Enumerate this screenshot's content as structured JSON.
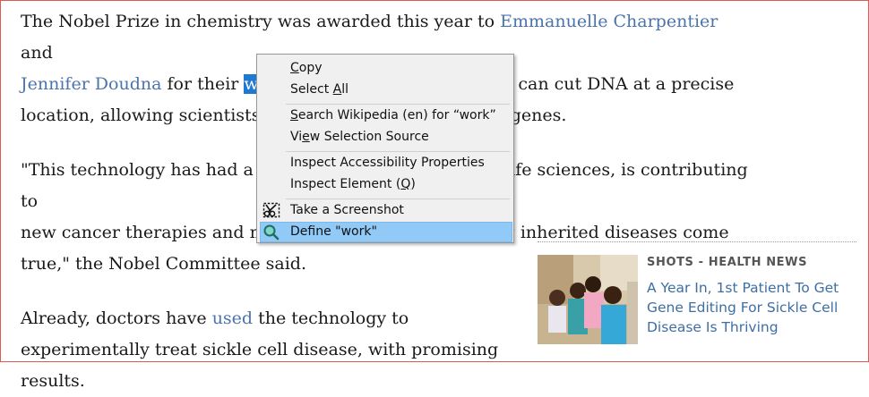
{
  "article": {
    "p1": {
      "t1": "The Nobel Prize in chemistry was awarded this year to ",
      "link1": "Emmanuelle Charpentier",
      "t2": " and",
      "link2": "Jennifer Doudna",
      "t3": " for their ",
      "selected": "work",
      "t4": " on \"genetic scissors\" that can cut DNA at a precise",
      "t5": "location, allowing scientists to make changes to specific genes."
    },
    "p2": {
      "l1": "\"This technology has had a revolutionary impact on the life sciences, is contributing to",
      "l2": "new cancer therapies and may make the dream of curing inherited diseases come",
      "l3": "true,\" the Nobel Committee said."
    },
    "p3": {
      "t1": "Already, doctors have ",
      "link": "used",
      "t2": " the technology to",
      "l2": "experimentally treat sickle cell disease, with promising",
      "l3": "results."
    }
  },
  "promo": {
    "kicker": "SHOTS - HEALTH NEWS",
    "headline_l1": "A Year In, 1st Patient To Get",
    "headline_l2": "Gene Editing For Sickle Cell",
    "headline_l3": "Disease Is Thriving"
  },
  "context_menu": {
    "items": [
      {
        "label": "Copy",
        "accel": "C"
      },
      {
        "label": "Select All",
        "accel": "A"
      },
      {
        "label": "Search Wikipedia (en) for “work”",
        "accel": "S"
      },
      {
        "label": "View Selection Source",
        "accel": "e"
      },
      {
        "label": "Inspect Accessibility Properties"
      },
      {
        "label": "Inspect Element (Q)",
        "accel": "Q"
      },
      {
        "label": "Take a Screenshot",
        "icon": "screenshot-scissors-icon"
      },
      {
        "label": "Define \"work\"",
        "icon": "magnifier-icon",
        "highlighted": true
      }
    ]
  },
  "colors": {
    "link": "#4b74aa",
    "selection": "#1f78d1",
    "menu_highlight": "#91c9f7",
    "frame_border": "#e05a55"
  }
}
